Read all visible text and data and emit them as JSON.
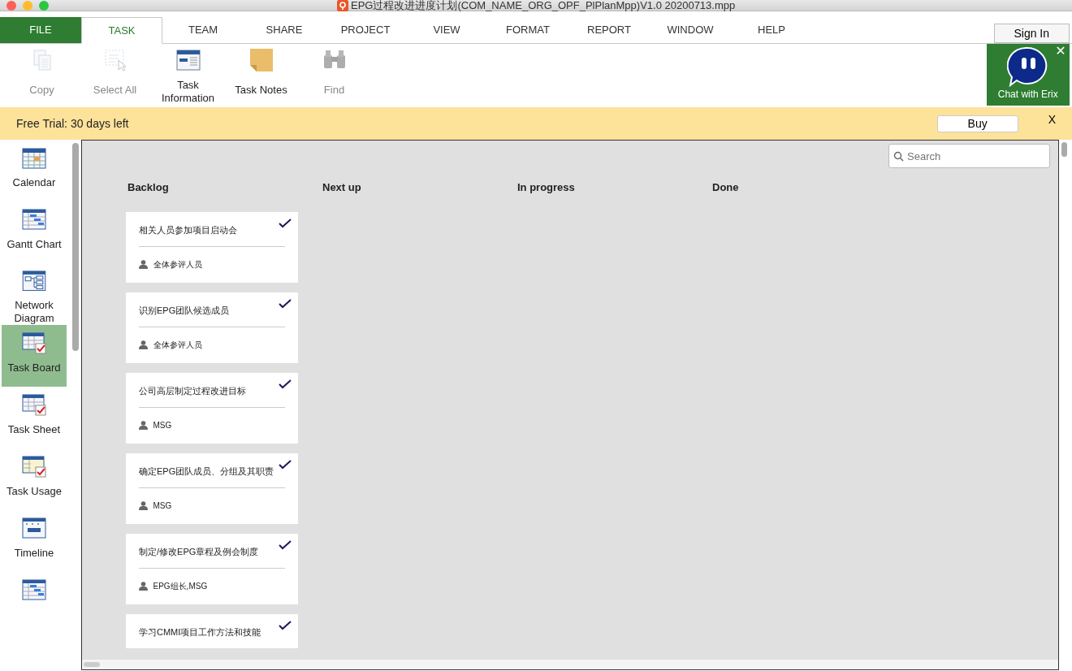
{
  "window": {
    "title": "EPG过程改进进度计划(COM_NAME_ORG_OPF_PlPlanMpp)V1.0 20200713.mpp"
  },
  "ribbon_tabs": [
    {
      "label": "FILE",
      "kind": "file",
      "selected": false
    },
    {
      "label": "TASK",
      "kind": "tab",
      "selected": true
    },
    {
      "label": "TEAM",
      "kind": "tab",
      "selected": false
    },
    {
      "label": "SHARE",
      "kind": "tab",
      "selected": false
    },
    {
      "label": "PROJECT",
      "kind": "tab",
      "selected": false
    },
    {
      "label": "VIEW",
      "kind": "tab",
      "selected": false
    },
    {
      "label": "FORMAT",
      "kind": "tab",
      "selected": false
    },
    {
      "label": "REPORT",
      "kind": "tab",
      "selected": false
    },
    {
      "label": "WINDOW",
      "kind": "tab",
      "selected": false
    },
    {
      "label": "HELP",
      "kind": "tab",
      "selected": false
    }
  ],
  "sign_in": "Sign In",
  "toolbar": [
    {
      "label": "Copy",
      "kind": "copy",
      "disabled": true
    },
    {
      "label": "Select All",
      "kind": "select",
      "disabled": true
    },
    {
      "label": "Task Information",
      "kind": "info",
      "disabled": false
    },
    {
      "label": "Task Notes",
      "kind": "notes",
      "disabled": false
    },
    {
      "label": "Find",
      "kind": "find",
      "disabled": true
    }
  ],
  "chat": {
    "label": "Chat with Erix",
    "close": "✕"
  },
  "trial_bar": {
    "message": "Free Trial: 30 days left",
    "button": "Buy",
    "close": "X"
  },
  "sidebar": {
    "items": [
      {
        "label": "Calendar",
        "kind": "calendar",
        "selected": false
      },
      {
        "label": "Gantt Chart",
        "kind": "gantt",
        "selected": false
      },
      {
        "label": "Network Diagram",
        "kind": "network",
        "selected": false
      },
      {
        "label": "Task Board",
        "kind": "board",
        "selected": true
      },
      {
        "label": "Task Sheet",
        "kind": "sheet",
        "selected": false
      },
      {
        "label": "Task Usage",
        "kind": "usage",
        "selected": false
      },
      {
        "label": "Timeline",
        "kind": "timeline",
        "selected": false
      },
      {
        "kind": "gantt",
        "selected": false
      }
    ]
  },
  "board": {
    "search": {
      "placeholder": "Search"
    },
    "columns": [
      {
        "title": "Backlog",
        "cards": [
          {
            "title": "相关人员参加项目启动会",
            "assignee": "全体参评人员",
            "done": true
          },
          {
            "title": "识别EPG团队候选成员",
            "assignee": "全体参评人员",
            "done": true
          },
          {
            "title": "公司高层制定过程改进目标",
            "assignee": "MSG",
            "done": true
          },
          {
            "title": "确定EPG团队成员、分组及其职责",
            "assignee": "MSG",
            "done": true
          },
          {
            "title": "制定/修改EPG章程及例会制度",
            "assignee": "EPG组长,MSG",
            "done": true
          },
          {
            "title": "学习CMMI项目工作方法和技能",
            "done": true
          }
        ]
      },
      {
        "title": "Next up"
      },
      {
        "title": "In progress"
      },
      {
        "title": "Done"
      }
    ]
  }
}
